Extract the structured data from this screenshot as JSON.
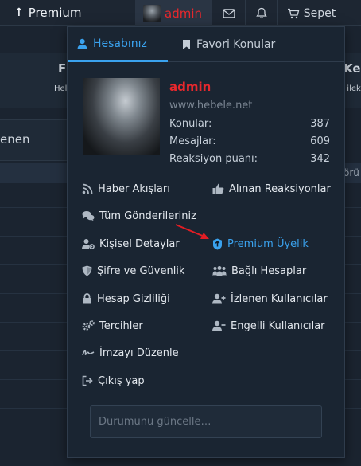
{
  "navbar": {
    "premium_label": "Premium",
    "username": "admin",
    "cart_label": "Sepet"
  },
  "background": {
    "frag_left": "F",
    "frag_right": "Ker",
    "frag_hel": "Hel",
    "frag_o": "o ilek",
    "frag_enen": "enen",
    "frag_oru": "örü"
  },
  "account_menu": {
    "tabs": [
      {
        "label": "Hesabınız",
        "active": true
      },
      {
        "label": "Favori Konular",
        "active": false
      }
    ],
    "profile": {
      "username": "admin",
      "website": "www.hebele.net",
      "stats": [
        {
          "label": "Konular:",
          "value": "387"
        },
        {
          "label": "Mesajlar:",
          "value": "609"
        },
        {
          "label": "Reaksiyon puanı:",
          "value": "342"
        }
      ]
    },
    "links_left": [
      {
        "label": "Haber Akışları",
        "icon": "rss-icon"
      },
      {
        "label": "Tüm Gönderileriniz",
        "icon": "comments-icon"
      },
      {
        "label": "Kişisel Detaylar",
        "icon": "user-cog-icon"
      },
      {
        "label": "Şifre ve Güvenlik",
        "icon": "shield-icon"
      },
      {
        "label": "Hesap Gizliliği",
        "icon": "lock-icon"
      },
      {
        "label": "Tercihler",
        "icon": "cogs-icon"
      },
      {
        "label": "İmzayı Düzenle",
        "icon": "signature-icon"
      },
      {
        "label": "Çıkış yap",
        "icon": "sign-out-icon"
      }
    ],
    "links_right": [
      {
        "label": "Alınan Reaksiyonlar",
        "icon": "thumbs-up-icon"
      },
      {
        "label": "Premium Üyelik",
        "icon": "premium-badge-icon",
        "highlight": true
      },
      {
        "label": "Bağlı Hesaplar",
        "icon": "users-icon"
      },
      {
        "label": "İzlenen Kullanıcılar",
        "icon": "user-plus-icon"
      },
      {
        "label": "Engelli Kullanıcılar",
        "icon": "user-minus-icon"
      }
    ],
    "status_placeholder": "Durumunu güncelle…"
  },
  "colors": {
    "accent": "#3aa2ee",
    "username_red": "#e8282d",
    "panel_bg": "#1a2532",
    "annotation_arrow": "#e11d24"
  }
}
